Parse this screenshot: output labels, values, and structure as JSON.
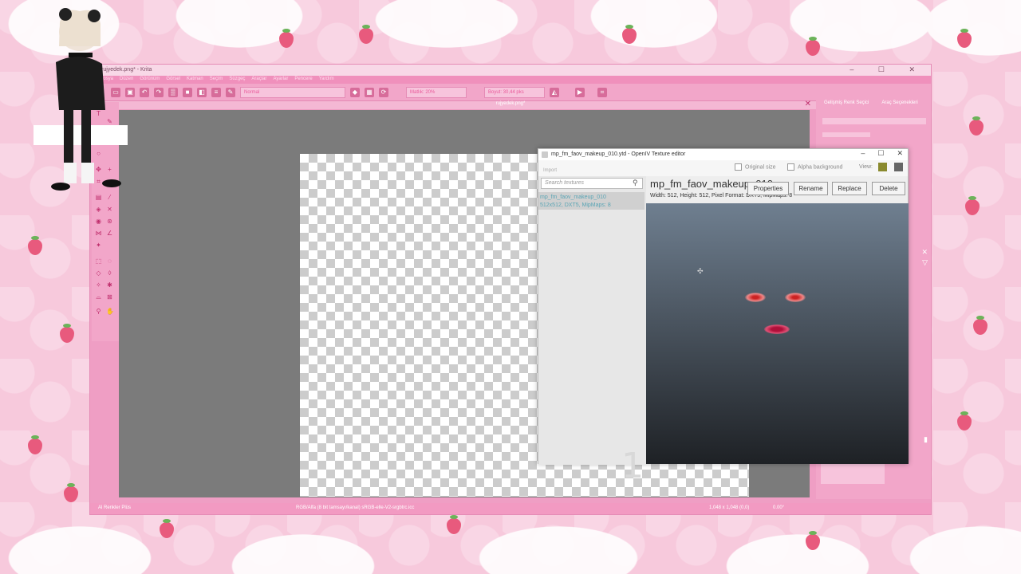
{
  "krita": {
    "title": "rujyedek.png* - Krita",
    "menu": [
      "Dosya",
      "Düzen",
      "Görünüm",
      "Görsel",
      "Katman",
      "Seçim",
      "Süzgeç",
      "Araçlar",
      "Ayarlar",
      "Pencere",
      "Yardım"
    ],
    "blend_mode": "Normal",
    "opacity": "Matlık: 20%",
    "size": "Boyut: 30,44 pks",
    "doc_tab": "rujyedek.png*",
    "dock_tab1": "Gelişmiş Renk Seçici",
    "dock_tab2": "Araç Seçenekleri",
    "status_left": "Al Renkler Plüs",
    "status_mid": "RGB/Alfa (8 bit tamsayı/kanal) sRGB-elle-V2-srgbtrc.icc",
    "status_right": "1,048 x 1,048 (0,0)",
    "status_zoom": "0.00°"
  },
  "openiv": {
    "title": "mp_fm_faov_makeup_010.ytd - OpenIV Texture editor",
    "import_label": "Import",
    "original_size_label": "Original size",
    "alpha_bg_label": "Alpha background",
    "view_label": "View:",
    "search_placeholder": "Search textures",
    "item_name": "mp_fm_faov_makeup_010",
    "item_info": "512x512, DXT5, MipMaps: 8",
    "texture_name": "mp_fm_faov_makeup_010",
    "texture_info": "Width: 512, Height: 512, Pixel Format: DXT5, MipMaps: 8",
    "buttons": {
      "properties": "Properties",
      "rename": "Rename",
      "replace": "Replace",
      "delete": "Delete"
    },
    "count": "1"
  },
  "colors": {
    "accent": "#ef9ec4",
    "preview_top": "#6f7f90",
    "preview_bottom": "#1e2125"
  },
  "icons": [
    "close-icon",
    "maximize-icon",
    "minimize-icon",
    "search-icon",
    "grid-view-icon",
    "list-view-icon"
  ]
}
